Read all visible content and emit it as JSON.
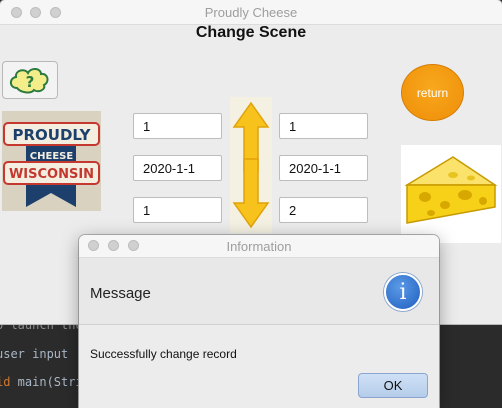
{
  "code_editor": {
    "line1": "o launch the",
    "line2_text": "user input",
    "line3_keyword": "id",
    "line3_rest": " main(Stri"
  },
  "main_window": {
    "title": "Proudly Cheese",
    "heading": "Change Scene",
    "help_icon": "question-cloud-icon",
    "return_label": "return",
    "logo_text": {
      "line1": "PROUDLY",
      "line2": "CHEESE",
      "line3": "WISCONSIN"
    },
    "left_fields": [
      "1",
      "2020-1-1",
      "1"
    ],
    "right_fields": [
      "1",
      "2020-1-1",
      "2"
    ],
    "swap_icon": "swap-arrows-icon",
    "cheese_icon": "cheese-wedge-icon",
    "colors": {
      "return": "#f39c12",
      "arrow": "#f6c21b",
      "cheese": "#f7d117"
    }
  },
  "dialog": {
    "title": "Information",
    "header": "Message",
    "info_icon": "i",
    "content": "Successfully change record",
    "ok_label": "OK"
  }
}
